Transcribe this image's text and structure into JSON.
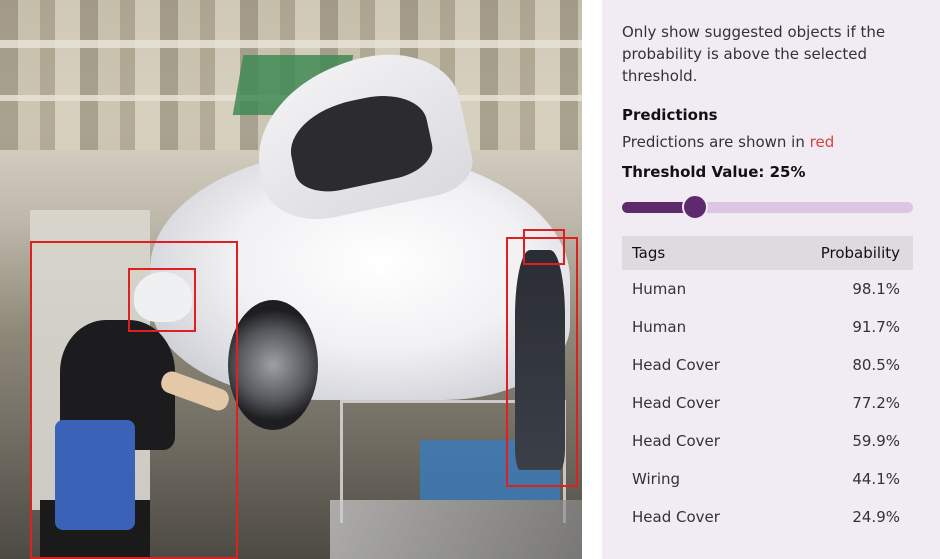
{
  "photo": {
    "icon": "factory-assembly-line-photo",
    "bbox_color": "#e02020"
  },
  "panel": {
    "info_text": "Only show suggested objects if the probability is above the selected threshold.",
    "predictions_title": "Predictions",
    "predictions_note_prefix": "Predictions are shown in ",
    "predictions_note_color_word": "red",
    "threshold_label": "Threshold Value: ",
    "threshold_value": "25%",
    "threshold_fraction": 0.25,
    "accent_color": "#5e2a6c",
    "table": {
      "headers": {
        "tags": "Tags",
        "probability": "Probability"
      },
      "rows": [
        {
          "tag": "Human",
          "probability": "98.1%"
        },
        {
          "tag": "Human",
          "probability": "91.7%"
        },
        {
          "tag": "Head Cover",
          "probability": "80.5%"
        },
        {
          "tag": "Head Cover",
          "probability": "77.2%"
        },
        {
          "tag": "Head Cover",
          "probability": "59.9%"
        },
        {
          "tag": "Wiring",
          "probability": "44.1%"
        },
        {
          "tag": "Head Cover",
          "probability": "24.9%"
        }
      ]
    }
  }
}
